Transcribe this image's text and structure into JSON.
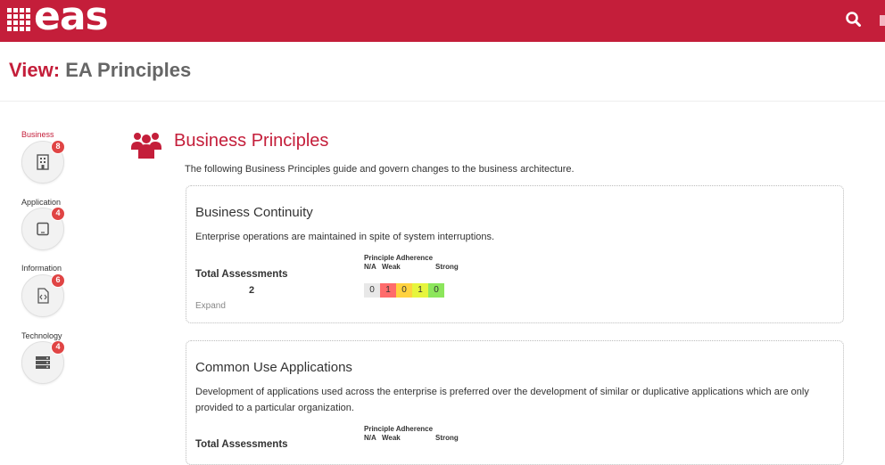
{
  "header": {
    "logo_text": "eas",
    "brand_color": "#c41e3a",
    "search_icon": "search-icon"
  },
  "page": {
    "title_prefix": "View:",
    "title": "EA Principles"
  },
  "sidebar": {
    "items": [
      {
        "label": "Business",
        "count": "8",
        "icon": "building-icon",
        "active": true
      },
      {
        "label": "Application",
        "count": "4",
        "icon": "tablet-icon",
        "active": false
      },
      {
        "label": "Information",
        "count": "6",
        "icon": "code-file-icon",
        "active": false
      },
      {
        "label": "Technology",
        "count": "4",
        "icon": "server-icon",
        "active": false
      }
    ]
  },
  "section": {
    "icon": "users-icon",
    "title": "Business Principles",
    "description": "The following Business Principles guide and govern changes to the business architecture."
  },
  "adherence": {
    "title": "Principle Adherence",
    "na_label": "N/A",
    "weak_label": "Weak",
    "strong_label": "Strong",
    "colors": [
      "#e8e8e8",
      "#ff6b6b",
      "#ffd23f",
      "#e6f53d",
      "#8ce65c"
    ]
  },
  "cards": [
    {
      "title": "Business Continuity",
      "description": "Enterprise operations are maintained in spite of system interruptions.",
      "total_label": "Total Assessments",
      "total_count": "2",
      "adherence_values": [
        "0",
        "1",
        "0",
        "1",
        "0"
      ],
      "expand_label": "Expand"
    },
    {
      "title": "Common Use Applications",
      "description": "Development of applications used across the enterprise is preferred over the development of similar or duplicative applications which are only provided to a particular organization.",
      "total_label": "Total Assessments",
      "total_count": "",
      "adherence_values": [],
      "expand_label": ""
    }
  ]
}
